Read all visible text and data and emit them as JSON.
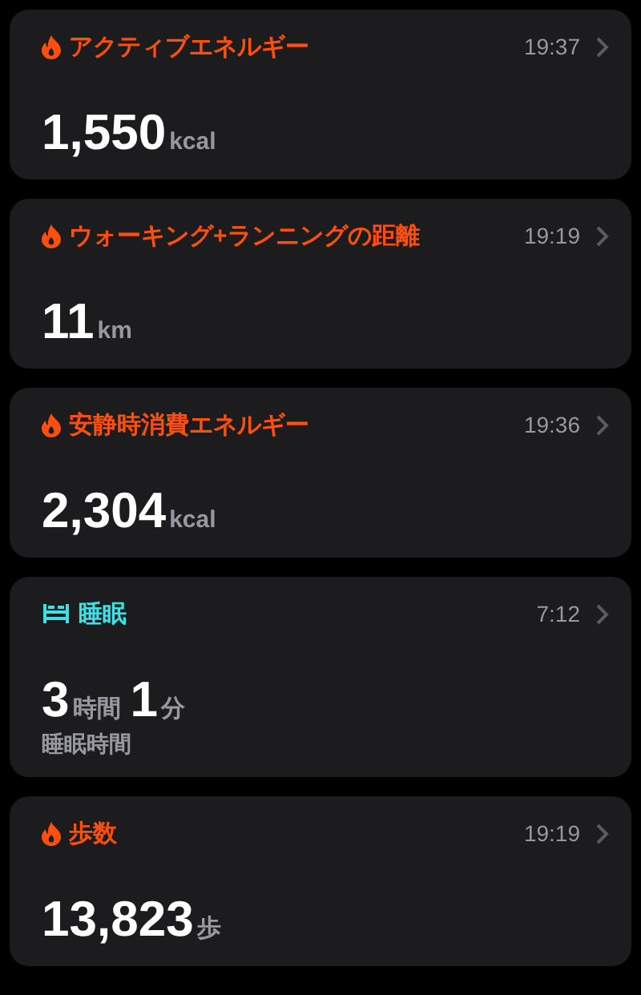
{
  "cards": [
    {
      "kind": "flame",
      "color": "#ff4f0f",
      "title": "アクティブエネルギー",
      "time": "19:37",
      "value": [
        {
          "number": "1,550",
          "unit": "kcal"
        }
      ]
    },
    {
      "kind": "flame",
      "color": "#ff4f0f",
      "title": "ウォーキング+ランニングの距離",
      "time": "19:19",
      "value": [
        {
          "number": "11",
          "unit": "km"
        }
      ]
    },
    {
      "kind": "flame",
      "color": "#ff4f0f",
      "title": "安静時消費エネルギー",
      "time": "19:36",
      "value": [
        {
          "number": "2,304",
          "unit": "kcal"
        }
      ]
    },
    {
      "kind": "bed",
      "color": "#3ee0e6",
      "title": "睡眠",
      "time": "7:12",
      "value": [
        {
          "number": "3",
          "unit": "時間"
        },
        {
          "number": "1",
          "unit": "分"
        }
      ],
      "subtitle": "睡眠時間"
    },
    {
      "kind": "flame",
      "color": "#ff4f0f",
      "title": "歩数",
      "time": "19:19",
      "value": [
        {
          "number": "13,823",
          "unit": "歩"
        }
      ]
    }
  ]
}
